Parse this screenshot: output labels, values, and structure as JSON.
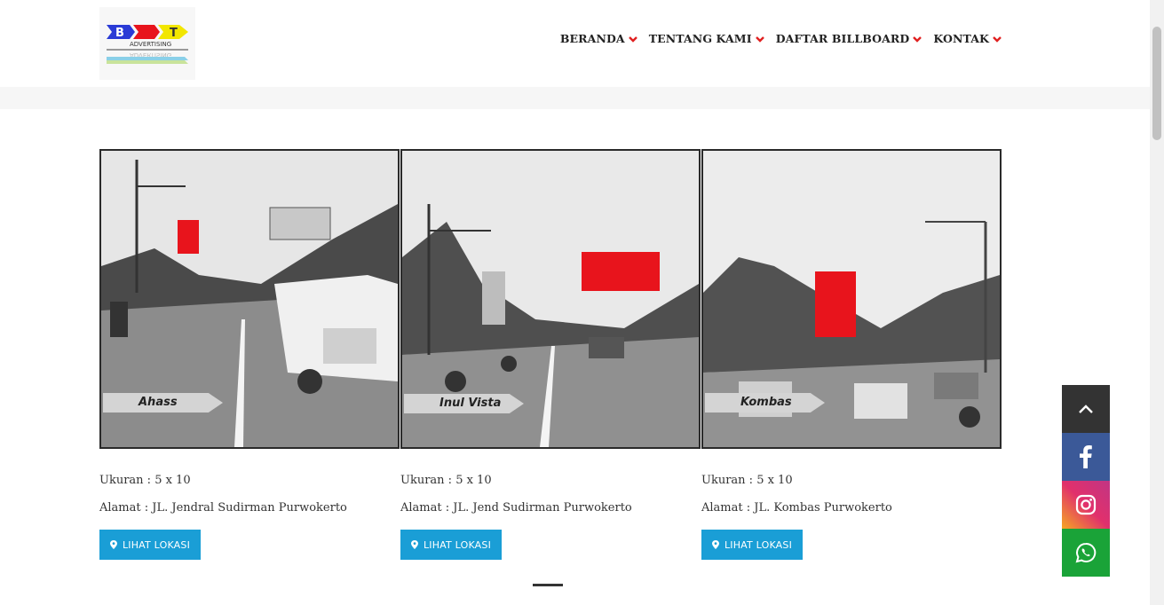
{
  "nav": {
    "items": [
      {
        "label": "BERANDA"
      },
      {
        "label": "TENTANG KAMI"
      },
      {
        "label": "DAFTAR BILLBOARD"
      },
      {
        "label": "KONTAK"
      }
    ]
  },
  "logo": {
    "text": "ADVERTISING"
  },
  "cards": [
    {
      "photo_label": "Ahass",
      "size": "Ukuran : 5 x 10",
      "address": "Alamat  : JL. Jendral Sudirman Purwokerto",
      "button": "LIHAT LOKASI"
    },
    {
      "photo_label": "Inul Vista",
      "size": "Ukuran : 5 x 10",
      "address": "Alamat  : JL. Jend Sudirman Purwokerto",
      "button": "LIHAT LOKASI"
    },
    {
      "photo_label": "Kombas",
      "size": "Ukuran : 5 x 10",
      "address": "Alamat  : JL. Kombas Purwokerto",
      "button": "LIHAT LOKASI"
    }
  ],
  "colors": {
    "accent": "#1a9ed6",
    "chevron": "#e02020",
    "facebook": "#3b5998",
    "whatsapp": "#1aa338",
    "billboard": "#e8141c"
  },
  "social": [
    "chevron-up-icon",
    "facebook-icon",
    "instagram-icon",
    "whatsapp-icon"
  ]
}
